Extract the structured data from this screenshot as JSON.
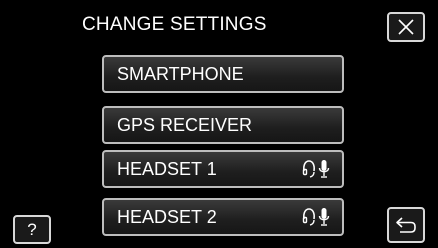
{
  "header": {
    "title": "CHANGE SETTINGS"
  },
  "menu": {
    "items": [
      {
        "label": "SMARTPHONE",
        "icons": []
      },
      {
        "label": "GPS RECEIVER",
        "icons": []
      },
      {
        "label": "HEADSET 1",
        "icons": [
          "headphone-icon",
          "microphone-icon"
        ]
      },
      {
        "label": "HEADSET 2",
        "icons": [
          "headphone-icon",
          "microphone-icon"
        ]
      }
    ]
  },
  "footer": {
    "help_label": "?"
  },
  "colors": {
    "background": "#000000",
    "button_border": "#bdbdbd",
    "text": "#ffffff"
  }
}
